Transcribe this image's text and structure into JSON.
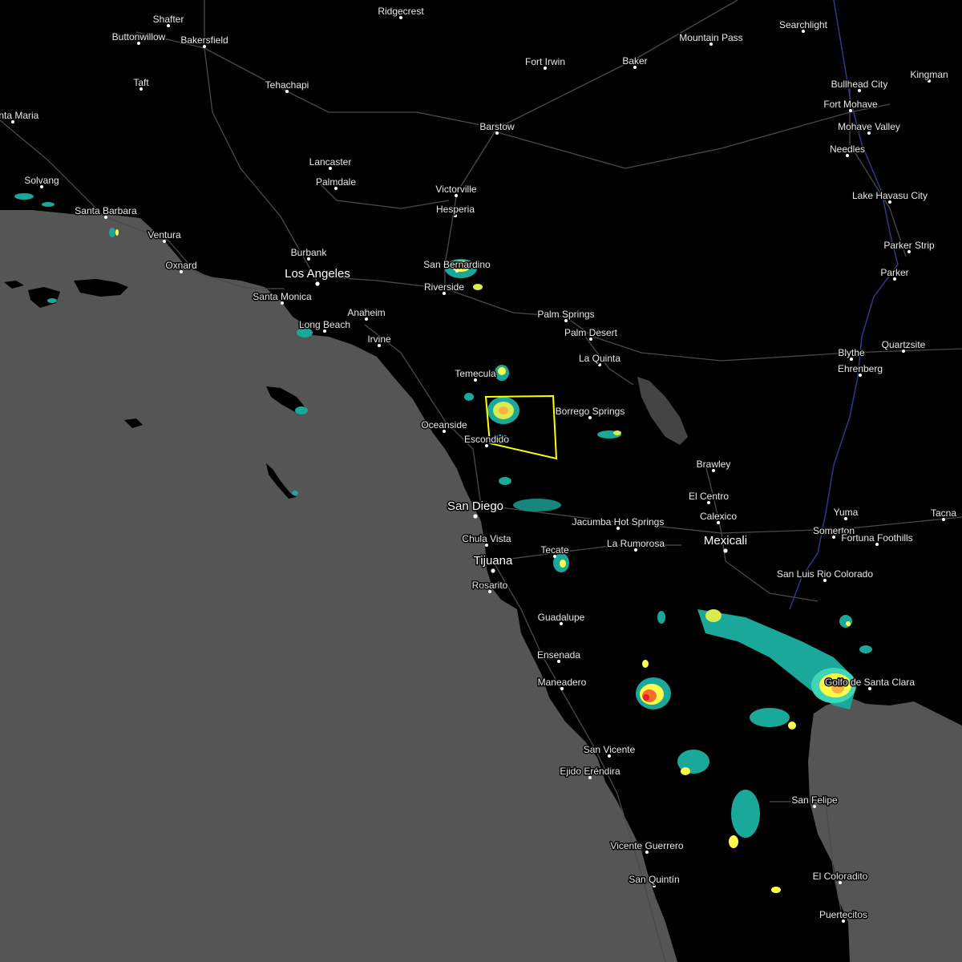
{
  "map": {
    "cities": [
      {
        "name": "Ridgecrest",
        "major": false
      },
      {
        "name": "Shafter",
        "major": false
      },
      {
        "name": "Buttonwillow",
        "major": false
      },
      {
        "name": "Bakersfield",
        "major": false
      },
      {
        "name": "Taft",
        "major": false
      },
      {
        "name": "Tehachapi",
        "major": false
      },
      {
        "name": "Santa Maria",
        "major": false
      },
      {
        "name": "Solvang",
        "major": false
      },
      {
        "name": "Santa Barbara",
        "major": false
      },
      {
        "name": "Ventura",
        "major": false
      },
      {
        "name": "Oxnard",
        "major": false
      },
      {
        "name": "Lancaster",
        "major": false
      },
      {
        "name": "Palmdale",
        "major": false
      },
      {
        "name": "Victorville",
        "major": false
      },
      {
        "name": "Hesperia",
        "major": false
      },
      {
        "name": "Barstow",
        "major": false
      },
      {
        "name": "Fort Irwin",
        "major": false
      },
      {
        "name": "Baker",
        "major": false
      },
      {
        "name": "Mountain Pass",
        "major": false
      },
      {
        "name": "Searchlight",
        "major": false
      },
      {
        "name": "Bullhead City",
        "major": false
      },
      {
        "name": "Kingman",
        "major": false
      },
      {
        "name": "Fort Mohave",
        "major": false
      },
      {
        "name": "Mohave Valley",
        "major": false
      },
      {
        "name": "Needles",
        "major": false
      },
      {
        "name": "Lake Havasu City",
        "major": false
      },
      {
        "name": "Parker Strip",
        "major": false
      },
      {
        "name": "Parker",
        "major": false
      },
      {
        "name": "Blythe",
        "major": false
      },
      {
        "name": "Ehrenberg",
        "major": false
      },
      {
        "name": "Quartzsite",
        "major": false
      },
      {
        "name": "Burbank",
        "major": false
      },
      {
        "name": "Los Angeles",
        "major": true
      },
      {
        "name": "Santa Monica",
        "major": false
      },
      {
        "name": "Anaheim",
        "major": false
      },
      {
        "name": "Irvine",
        "major": false
      },
      {
        "name": "Long Beach",
        "major": false
      },
      {
        "name": "San Bernardino",
        "major": false
      },
      {
        "name": "Riverside",
        "major": false
      },
      {
        "name": "Palm Springs",
        "major": false
      },
      {
        "name": "Palm Desert",
        "major": false
      },
      {
        "name": "La Quinta",
        "major": false
      },
      {
        "name": "Temecula",
        "major": false
      },
      {
        "name": "Oceanside",
        "major": false
      },
      {
        "name": "Escondido",
        "major": false
      },
      {
        "name": "Borrego Springs",
        "major": false
      },
      {
        "name": "Brawley",
        "major": false
      },
      {
        "name": "El Centro",
        "major": false
      },
      {
        "name": "San Diego",
        "major": true
      },
      {
        "name": "Chula Vista",
        "major": false
      },
      {
        "name": "Tijuana",
        "major": true
      },
      {
        "name": "Rosarito",
        "major": false
      },
      {
        "name": "Tecate",
        "major": false
      },
      {
        "name": "Jacumba Hot Springs",
        "major": false
      },
      {
        "name": "La Rumorosa",
        "major": false
      },
      {
        "name": "Calexico",
        "major": false
      },
      {
        "name": "Mexicali",
        "major": true
      },
      {
        "name": "Yuma",
        "major": false
      },
      {
        "name": "Somerton",
        "major": false
      },
      {
        "name": "Fortuna Foothills",
        "major": false
      },
      {
        "name": "Tacna",
        "major": false
      },
      {
        "name": "San Luis Rio Colorado",
        "major": false
      },
      {
        "name": "Guadalupe",
        "major": false
      },
      {
        "name": "Ensenada",
        "major": false
      },
      {
        "name": "Maneadero",
        "major": false
      },
      {
        "name": "San Vicente",
        "major": false
      },
      {
        "name": "Ejido Eréndira",
        "major": false
      },
      {
        "name": "Vicente Guerrero",
        "major": false
      },
      {
        "name": "San Quintín",
        "major": false
      },
      {
        "name": "San Felipe",
        "major": false
      },
      {
        "name": "El Coloradito",
        "major": false
      },
      {
        "name": "Puertecitos",
        "major": false
      },
      {
        "name": "Golfo de Santa Clara",
        "major": false
      }
    ],
    "warning_polygon_color": "#ffff00",
    "radar_colors": [
      "#1aa89a",
      "#35c9a0",
      "#3fd6b8",
      "#d8ec50",
      "#ffff4a",
      "#ffb040",
      "#ff6a2a",
      "#e0202a"
    ]
  }
}
